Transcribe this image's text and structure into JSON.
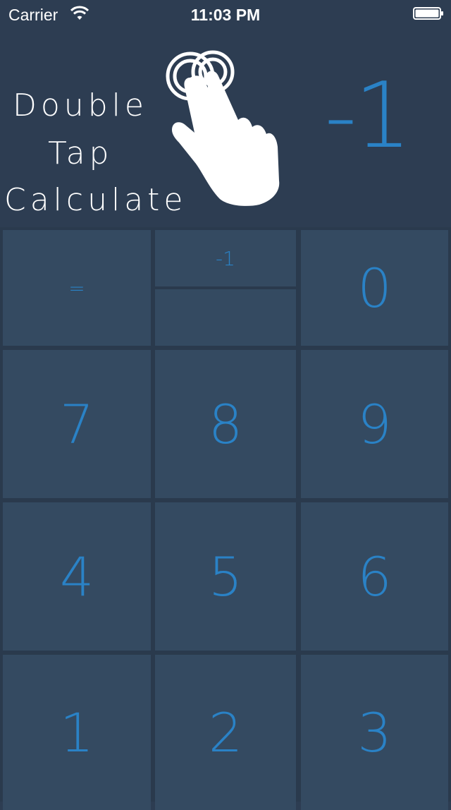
{
  "status_bar": {
    "carrier": "Carrier",
    "time": "11:03 PM"
  },
  "header": {
    "title_line1": "Double",
    "title_line2": "Tap",
    "title_line3": "Calculate",
    "display_value": "-1",
    "hand_icon": "double-tap-hand-icon"
  },
  "keypad": {
    "equals": "=",
    "history_top": "-1",
    "history_bottom": "",
    "keys": {
      "k0": "0",
      "k1": "1",
      "k2": "2",
      "k3": "3",
      "k4": "4",
      "k5": "5",
      "k6": "6",
      "k7": "7",
      "k8": "8",
      "k9": "9"
    }
  },
  "colors": {
    "background": "#2d3d52",
    "key": "#344a61",
    "accent": "#2a82c6",
    "title": "#ffffff"
  }
}
